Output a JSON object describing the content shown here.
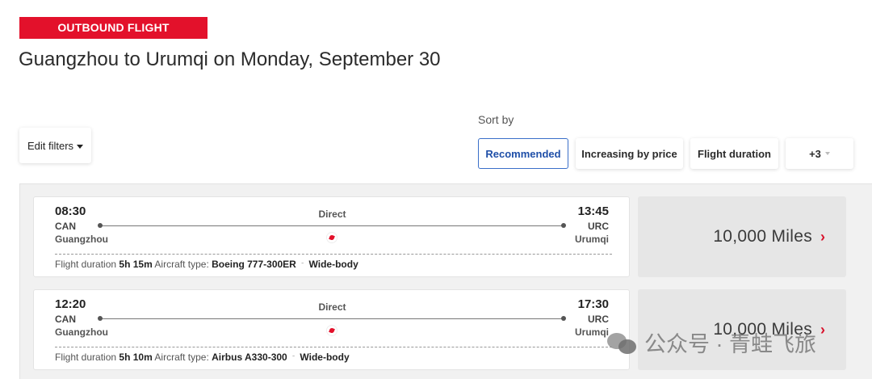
{
  "header": {
    "badge": "OUTBOUND FLIGHT",
    "title": "Guangzhou to Urumqi on Monday, September 30"
  },
  "filters": {
    "edit_label": "Edit filters"
  },
  "sort": {
    "label": "Sort by",
    "options": [
      {
        "label": "Recommended",
        "active": true
      },
      {
        "label": "Increasing by price",
        "active": false
      },
      {
        "label": "Flight duration",
        "active": false
      },
      {
        "label": "+3",
        "active": false
      }
    ]
  },
  "flights": [
    {
      "dep_time": "08:30",
      "dep_code": "CAN",
      "dep_city": "Guangzhou",
      "arr_time": "13:45",
      "arr_code": "URC",
      "arr_city": "Urumqi",
      "stops": "Direct",
      "duration_label": "Flight duration",
      "duration": "5h 15m",
      "aircraft_label": "Aircraft type:",
      "aircraft": "Boeing 777-300ER",
      "body": "Wide-body",
      "price": "10,000 Miles"
    },
    {
      "dep_time": "12:20",
      "dep_code": "CAN",
      "dep_city": "Guangzhou",
      "arr_time": "17:30",
      "arr_code": "URC",
      "arr_city": "Urumqi",
      "stops": "Direct",
      "duration_label": "Flight duration",
      "duration": "5h 10m",
      "aircraft_label": "Aircraft type:",
      "aircraft": "Airbus A330-300",
      "body": "Wide-body",
      "price": "10,000 Miles"
    }
  ],
  "watermark": {
    "text": "公众号 · 青蛙飞旅"
  },
  "icons": {
    "sort_more": "chevron-down-icon",
    "price_arrow": "chevron-right-icon",
    "airline": "airline-logo-icon"
  },
  "colors": {
    "brand_red": "#e3112b",
    "active_blue": "#3a6fc9"
  }
}
